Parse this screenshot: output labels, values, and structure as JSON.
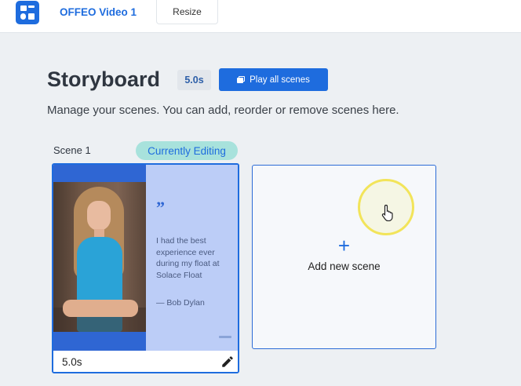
{
  "topbar": {
    "logo_icon": "offeo-logo-icon",
    "project_title": "OFFEO Video 1",
    "resize_label": "Resize"
  },
  "storyboard": {
    "title": "Storyboard",
    "total_duration": "5.0s",
    "play_all_label": "Play all scenes",
    "play_icon": "play-all-icon",
    "description": "Manage your scenes. You can add, reorder or remove scenes here."
  },
  "scenes": [
    {
      "label": "Scene 1",
      "status_badge": "Currently Editing",
      "duration": "5.0s",
      "edit_icon": "pencil-icon",
      "thumbnail": {
        "quote_mark": "”",
        "quote": "I had the best experience ever during my float at Solace Float",
        "author": "— Bob Dylan"
      }
    }
  ],
  "add_scene": {
    "icon": "plus-icon",
    "label": "Add new scene"
  },
  "colors": {
    "accent": "#1e6cde",
    "badge_teal": "#a8e2dc",
    "page_bg": "#edf0f3",
    "thumbnail_bg": "#bccdf7"
  }
}
